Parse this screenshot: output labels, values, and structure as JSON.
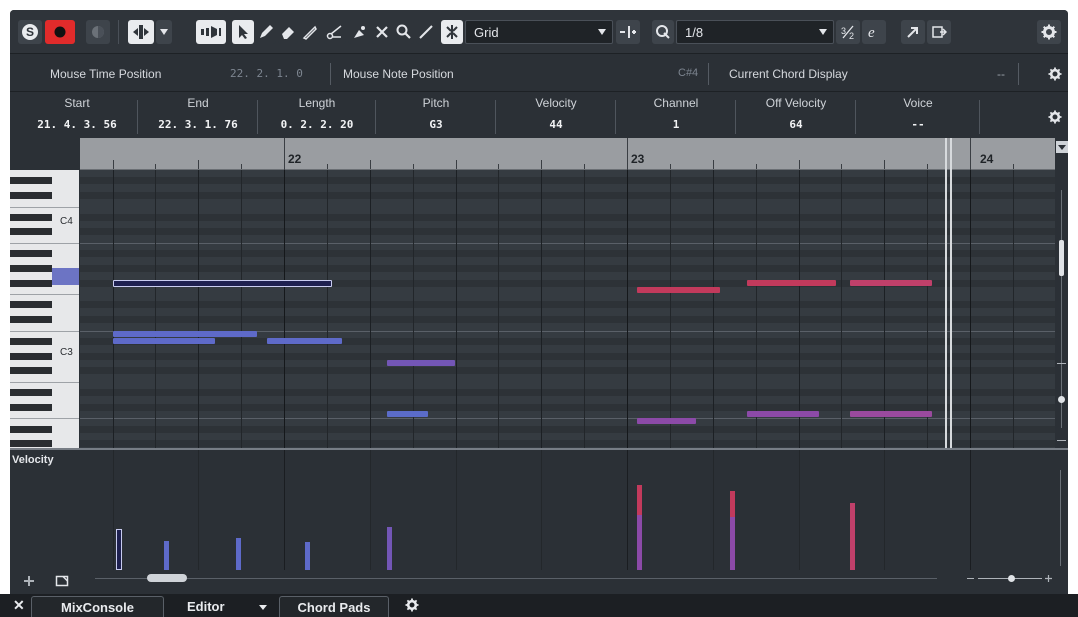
{
  "toolbar": {
    "grid_select": "Grid",
    "quantize_value": "1/8",
    "icons": [
      "solo-icon",
      "record-icon",
      "monitor-icon",
      "arrow-tool-icon",
      "pencil-icon",
      "eraser-icon",
      "draw-icon",
      "split-icon",
      "glue-icon",
      "mute-tool-icon",
      "zoom-icon",
      "line-icon",
      "snap-icon",
      "quantize-icon",
      "triplet-icon",
      "swing-icon",
      "settings-icon"
    ]
  },
  "status": {
    "mouse_time_label": "Mouse Time Position",
    "mouse_time_value": "22. 2. 1.  0",
    "mouse_note_label": "Mouse Note Position",
    "mouse_note_value": "C#4",
    "chord_label": "Current Chord Display",
    "chord_value": "--"
  },
  "info_line": [
    {
      "label": "Start",
      "value": "21. 4. 3. 56"
    },
    {
      "label": "End",
      "value": "22. 3. 1. 76"
    },
    {
      "label": "Length",
      "value": "0. 2. 2. 20"
    },
    {
      "label": "Pitch",
      "value": "G3"
    },
    {
      "label": "Velocity",
      "value": "44"
    },
    {
      "label": "Channel",
      "value": "1"
    },
    {
      "label": "Off Velocity",
      "value": "64"
    },
    {
      "label": "Voice",
      "value": "--"
    }
  ],
  "ruler": {
    "bars": [
      "22",
      "23",
      "24"
    ]
  },
  "keyboard": {
    "labels": [
      "C4",
      "C3"
    ]
  },
  "velocity_lane": {
    "label": "Velocity"
  },
  "notes": [
    {
      "start": 21.07,
      "len": 0.16,
      "row": 15,
      "color": "#7a5bb0"
    },
    {
      "start": 21.5,
      "len": 0.64,
      "row": 15,
      "color": "#1e2050",
      "selected": true
    },
    {
      "start": 21.5,
      "len": 0.42,
      "row": 22,
      "color": "#5e6ac9"
    },
    {
      "start": 21.5,
      "len": 0.3,
      "row": 23,
      "color": "#5e6ac9"
    },
    {
      "start": 21.95,
      "len": 0.22,
      "row": 23,
      "color": "#5e6ac9"
    },
    {
      "start": 22.3,
      "len": 0.2,
      "row": 26,
      "color": "#7356b6"
    },
    {
      "start": 22.3,
      "len": 0.12,
      "row": 33,
      "color": "#5b6cc9"
    },
    {
      "start": 23.03,
      "len": 0.24,
      "row": 16,
      "color": "#c23a5c"
    },
    {
      "start": 23.35,
      "len": 0.26,
      "row": 15,
      "color": "#c23a5c"
    },
    {
      "start": 23.65,
      "len": 0.24,
      "row": 15,
      "color": "#c0406a"
    },
    {
      "start": 23.03,
      "len": 0.17,
      "row": 34,
      "color": "#8c4aa8"
    },
    {
      "start": 23.35,
      "len": 0.21,
      "row": 33,
      "color": "#8c4aa8"
    },
    {
      "start": 23.65,
      "len": 0.24,
      "row": 33,
      "color": "#9a4a9e"
    }
  ],
  "velocities": [
    {
      "pos": 21.09,
      "value": 0.42,
      "color": "#7a5bb0"
    },
    {
      "pos": 21.51,
      "value": 0.34,
      "color": "#1e2050",
      "selected": true
    },
    {
      "pos": 21.65,
      "value": 0.24,
      "color": "#5e6ac9"
    },
    {
      "pos": 21.86,
      "value": 0.27,
      "color": "#5e6ac9"
    },
    {
      "pos": 22.06,
      "value": 0.23,
      "color": "#5e6ac9"
    },
    {
      "pos": 22.3,
      "value": 0.36,
      "color": "#7356b6"
    },
    {
      "pos": 23.03,
      "value": 0.71,
      "color": "#c23a5c"
    },
    {
      "pos": 23.03,
      "value": 0.46,
      "color": "#8c4aa8"
    },
    {
      "pos": 23.3,
      "value": 0.66,
      "color": "#c23a5c"
    },
    {
      "pos": 23.3,
      "value": 0.44,
      "color": "#8c4aa8"
    },
    {
      "pos": 23.65,
      "value": 0.56,
      "color": "#c0406a"
    }
  ],
  "tabs": {
    "close": "✕",
    "mixconsole": "MixConsole",
    "editor": "Editor",
    "chord_pads": "Chord Pads"
  }
}
